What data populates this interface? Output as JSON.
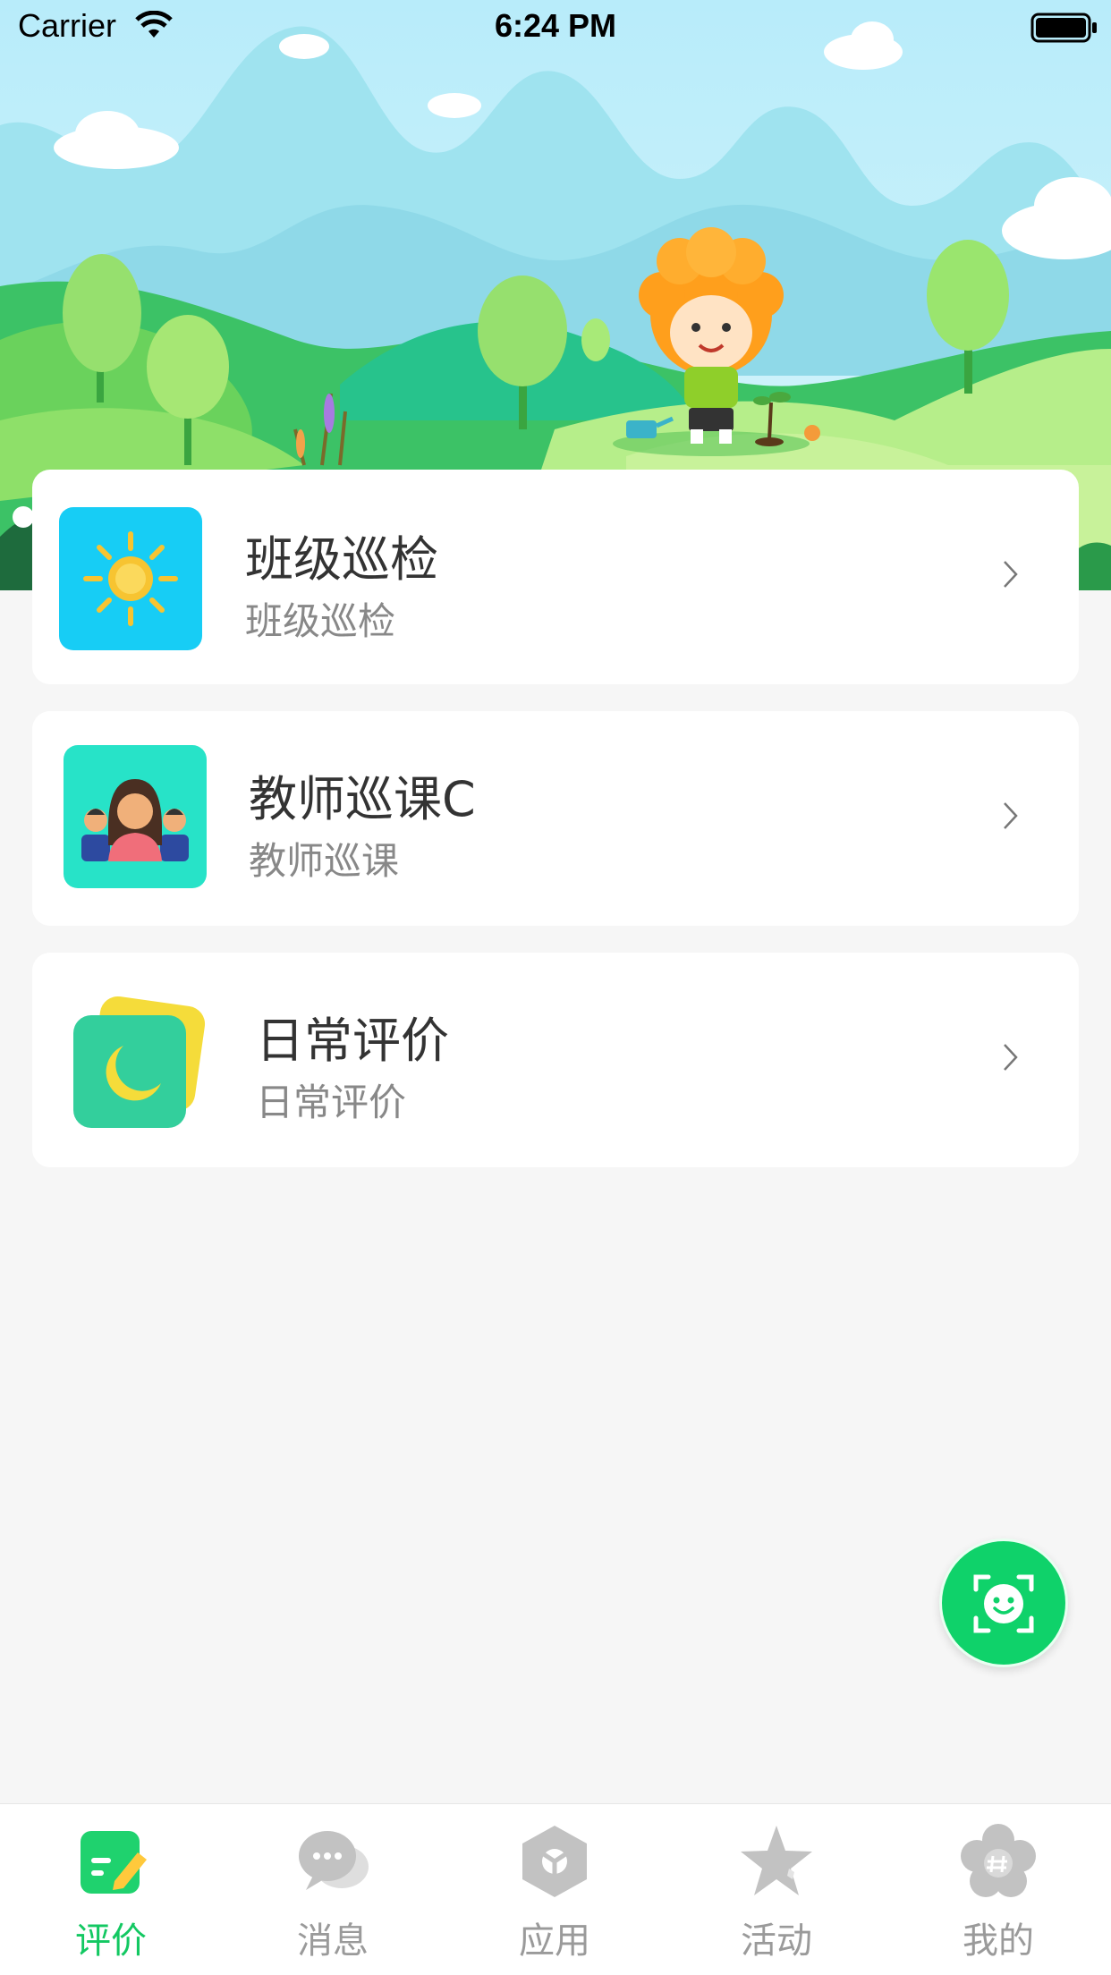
{
  "status_bar": {
    "carrier": "Carrier",
    "time": "6:24 PM"
  },
  "cards": [
    {
      "title": "班级巡检",
      "subtitle": "班级巡检",
      "icon": "sun-icon"
    },
    {
      "title": "教师巡课C",
      "subtitle": "教师巡课",
      "icon": "teacher-group-icon"
    },
    {
      "title": "日常评价",
      "subtitle": "日常评价",
      "icon": "moon-icon"
    }
  ],
  "fab": {
    "icon": "face-scan-icon"
  },
  "tabs": [
    {
      "label": "评价",
      "icon": "evaluate-icon",
      "active": true
    },
    {
      "label": "消息",
      "icon": "message-icon",
      "active": false
    },
    {
      "label": "应用",
      "icon": "apps-icon",
      "active": false
    },
    {
      "label": "活动",
      "icon": "star-icon",
      "active": false
    },
    {
      "label": "我的",
      "icon": "profile-flower-icon",
      "active": false
    }
  ],
  "colors": {
    "accent": "#13c862",
    "fab": "#0fd26a",
    "background": "#f6f6f6",
    "title_text": "#333333",
    "subtitle_text": "#888888",
    "tab_inactive": "#9a9a9a"
  }
}
